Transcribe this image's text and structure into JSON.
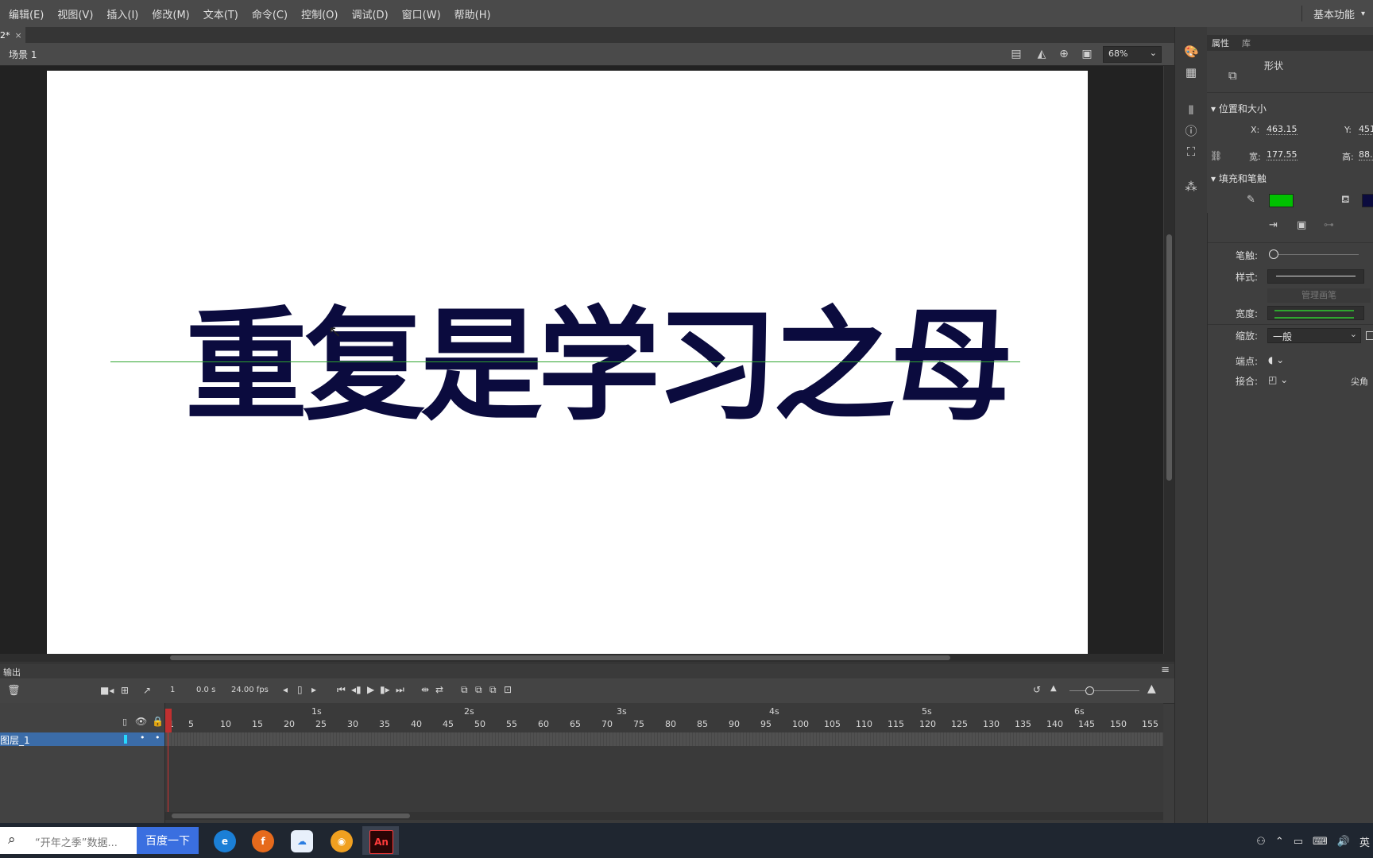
{
  "menu": [
    "编辑(E)",
    "视图(V)",
    "插入(I)",
    "修改(M)",
    "文本(T)",
    "命令(C)",
    "控制(O)",
    "调试(D)",
    "窗口(W)",
    "帮助(H)"
  ],
  "workspace": {
    "label": "基本功能",
    "caret": "▾"
  },
  "doc_tab": {
    "name": "2*",
    "close": "×"
  },
  "scene": {
    "label": "场景 1"
  },
  "zoom": {
    "value": "68%",
    "caret": "⌄"
  },
  "stage": {
    "text": "重复是学习之母",
    "text_color": "#0b0b3e",
    "guide_color": "#2fa52f"
  },
  "output": {
    "label": "输出"
  },
  "timeline": {
    "current_frame": "1",
    "time": "0.0 s",
    "fps": "24.00 fps",
    "seconds": [
      "1s",
      "2s",
      "3s",
      "4s",
      "5s",
      "6s"
    ],
    "ticks": [
      "1",
      "5",
      "10",
      "15",
      "20",
      "25",
      "30",
      "35",
      "40",
      "45",
      "50",
      "55",
      "60",
      "65",
      "70",
      "75",
      "80",
      "85",
      "90",
      "95",
      "100",
      "105",
      "110",
      "115",
      "120",
      "125",
      "130",
      "135",
      "140",
      "145",
      "150",
      "155"
    ],
    "layer_name": "图层_1"
  },
  "properties": {
    "tabs": [
      "属性",
      "库"
    ],
    "type": "形状",
    "pos_section": "位置和大小",
    "x_label": "X:",
    "x_value": "463.15",
    "y_label": "Y:",
    "y_value": "451",
    "w_label": "宽:",
    "w_value": "177.55",
    "h_label": "高:",
    "h_value": "88.",
    "fill_section": "填充和笔触",
    "stroke_color": "#00c000",
    "fill_color": "#0b0b3e",
    "stroke_label": "笔触:",
    "style_label": "样式:",
    "manage_label": "管理画笔",
    "width_label": "宽度:",
    "scale_label": "缩放:",
    "scale_value": "一般",
    "cap_label": "端点:",
    "join_label": "接合:",
    "join_value": "尖角"
  },
  "taskbar": {
    "search_placeholder": "“开年之季”数据...",
    "search_button": "百度一下",
    "apps": [
      "edge-icon",
      "firefox-icon",
      "baidu-netdisk-icon",
      "video-app-icon",
      "animate-icon"
    ],
    "animate_label": "An",
    "tray_lang": "英"
  }
}
